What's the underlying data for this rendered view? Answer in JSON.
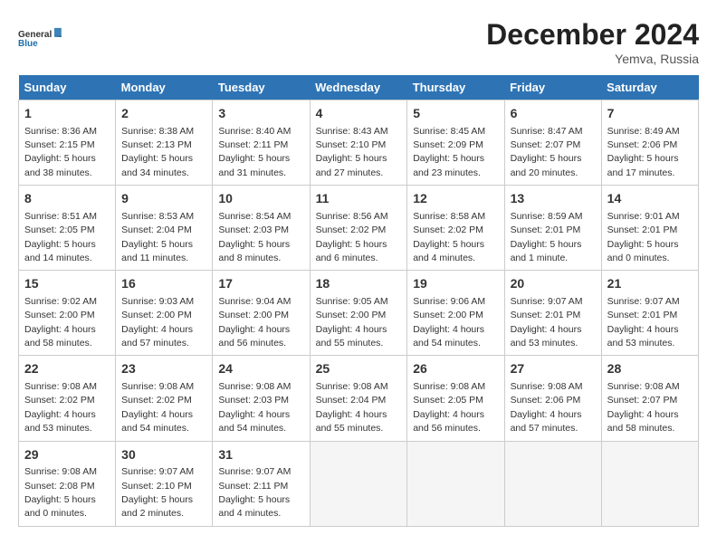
{
  "header": {
    "logo_line1": "General",
    "logo_line2": "Blue",
    "month": "December 2024",
    "location": "Yemva, Russia"
  },
  "days_of_week": [
    "Sunday",
    "Monday",
    "Tuesday",
    "Wednesday",
    "Thursday",
    "Friday",
    "Saturday"
  ],
  "weeks": [
    [
      {
        "num": "1",
        "sunrise": "8:36 AM",
        "sunset": "2:15 PM",
        "daylight": "5 hours and 38 minutes."
      },
      {
        "num": "2",
        "sunrise": "8:38 AM",
        "sunset": "2:13 PM",
        "daylight": "5 hours and 34 minutes."
      },
      {
        "num": "3",
        "sunrise": "8:40 AM",
        "sunset": "2:11 PM",
        "daylight": "5 hours and 31 minutes."
      },
      {
        "num": "4",
        "sunrise": "8:43 AM",
        "sunset": "2:10 PM",
        "daylight": "5 hours and 27 minutes."
      },
      {
        "num": "5",
        "sunrise": "8:45 AM",
        "sunset": "2:09 PM",
        "daylight": "5 hours and 23 minutes."
      },
      {
        "num": "6",
        "sunrise": "8:47 AM",
        "sunset": "2:07 PM",
        "daylight": "5 hours and 20 minutes."
      },
      {
        "num": "7",
        "sunrise": "8:49 AM",
        "sunset": "2:06 PM",
        "daylight": "5 hours and 17 minutes."
      }
    ],
    [
      {
        "num": "8",
        "sunrise": "8:51 AM",
        "sunset": "2:05 PM",
        "daylight": "5 hours and 14 minutes."
      },
      {
        "num": "9",
        "sunrise": "8:53 AM",
        "sunset": "2:04 PM",
        "daylight": "5 hours and 11 minutes."
      },
      {
        "num": "10",
        "sunrise": "8:54 AM",
        "sunset": "2:03 PM",
        "daylight": "5 hours and 8 minutes."
      },
      {
        "num": "11",
        "sunrise": "8:56 AM",
        "sunset": "2:02 PM",
        "daylight": "5 hours and 6 minutes."
      },
      {
        "num": "12",
        "sunrise": "8:58 AM",
        "sunset": "2:02 PM",
        "daylight": "5 hours and 4 minutes."
      },
      {
        "num": "13",
        "sunrise": "8:59 AM",
        "sunset": "2:01 PM",
        "daylight": "5 hours and 1 minute."
      },
      {
        "num": "14",
        "sunrise": "9:01 AM",
        "sunset": "2:01 PM",
        "daylight": "5 hours and 0 minutes."
      }
    ],
    [
      {
        "num": "15",
        "sunrise": "9:02 AM",
        "sunset": "2:00 PM",
        "daylight": "4 hours and 58 minutes."
      },
      {
        "num": "16",
        "sunrise": "9:03 AM",
        "sunset": "2:00 PM",
        "daylight": "4 hours and 57 minutes."
      },
      {
        "num": "17",
        "sunrise": "9:04 AM",
        "sunset": "2:00 PM",
        "daylight": "4 hours and 56 minutes."
      },
      {
        "num": "18",
        "sunrise": "9:05 AM",
        "sunset": "2:00 PM",
        "daylight": "4 hours and 55 minutes."
      },
      {
        "num": "19",
        "sunrise": "9:06 AM",
        "sunset": "2:00 PM",
        "daylight": "4 hours and 54 minutes."
      },
      {
        "num": "20",
        "sunrise": "9:07 AM",
        "sunset": "2:01 PM",
        "daylight": "4 hours and 53 minutes."
      },
      {
        "num": "21",
        "sunrise": "9:07 AM",
        "sunset": "2:01 PM",
        "daylight": "4 hours and 53 minutes."
      }
    ],
    [
      {
        "num": "22",
        "sunrise": "9:08 AM",
        "sunset": "2:02 PM",
        "daylight": "4 hours and 53 minutes."
      },
      {
        "num": "23",
        "sunrise": "9:08 AM",
        "sunset": "2:02 PM",
        "daylight": "4 hours and 54 minutes."
      },
      {
        "num": "24",
        "sunrise": "9:08 AM",
        "sunset": "2:03 PM",
        "daylight": "4 hours and 54 minutes."
      },
      {
        "num": "25",
        "sunrise": "9:08 AM",
        "sunset": "2:04 PM",
        "daylight": "4 hours and 55 minutes."
      },
      {
        "num": "26",
        "sunrise": "9:08 AM",
        "sunset": "2:05 PM",
        "daylight": "4 hours and 56 minutes."
      },
      {
        "num": "27",
        "sunrise": "9:08 AM",
        "sunset": "2:06 PM",
        "daylight": "4 hours and 57 minutes."
      },
      {
        "num": "28",
        "sunrise": "9:08 AM",
        "sunset": "2:07 PM",
        "daylight": "4 hours and 58 minutes."
      }
    ],
    [
      {
        "num": "29",
        "sunrise": "9:08 AM",
        "sunset": "2:08 PM",
        "daylight": "5 hours and 0 minutes."
      },
      {
        "num": "30",
        "sunrise": "9:07 AM",
        "sunset": "2:10 PM",
        "daylight": "5 hours and 2 minutes."
      },
      {
        "num": "31",
        "sunrise": "9:07 AM",
        "sunset": "2:11 PM",
        "daylight": "5 hours and 4 minutes."
      },
      null,
      null,
      null,
      null
    ]
  ],
  "labels": {
    "sunrise": "Sunrise:",
    "sunset": "Sunset:",
    "daylight": "Daylight:"
  }
}
